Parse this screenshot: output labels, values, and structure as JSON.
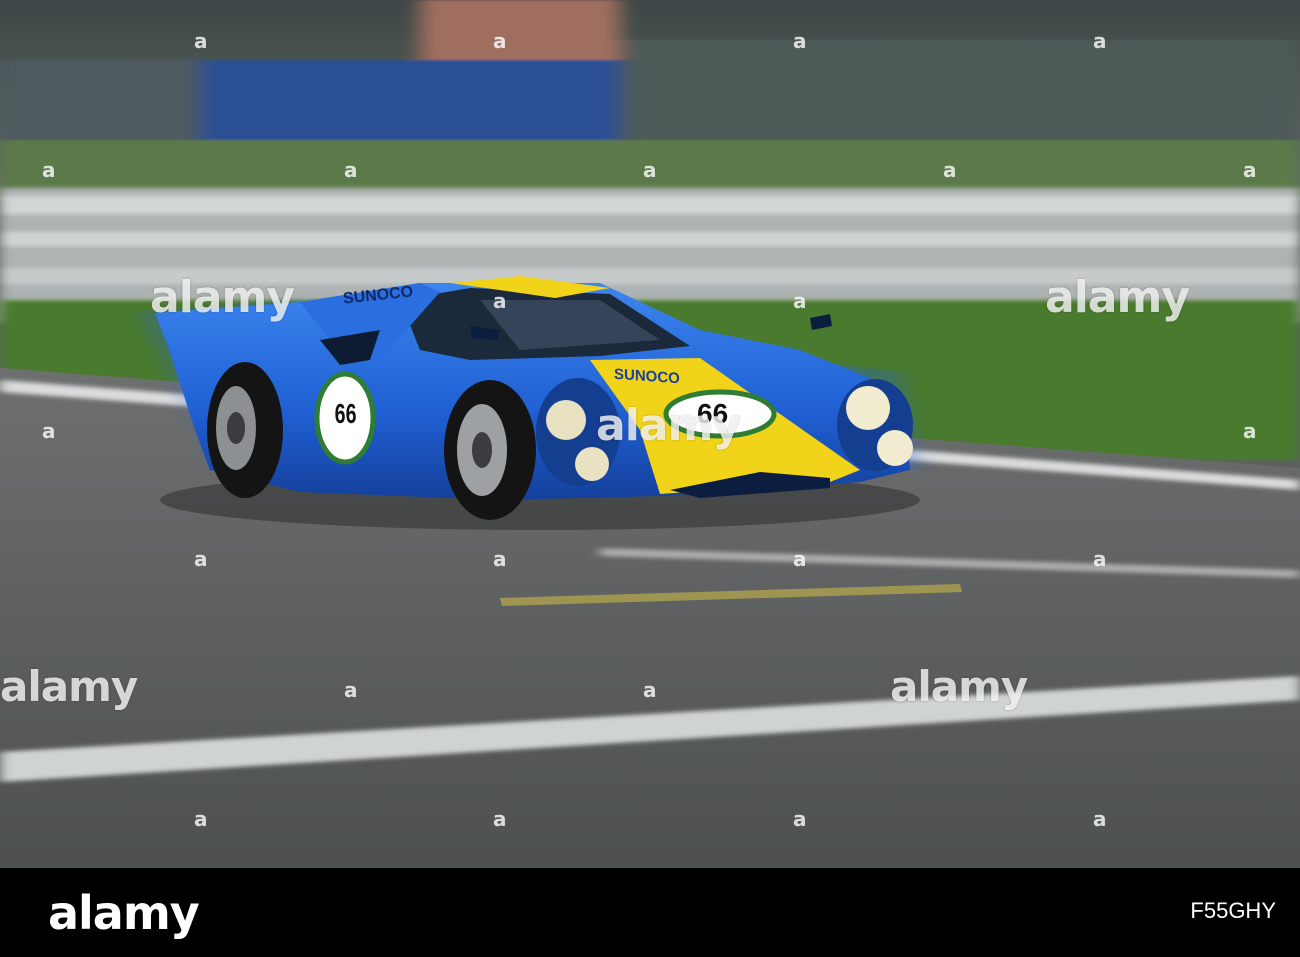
{
  "photo": {
    "subject": "blue and yellow classic race car number 66 on track",
    "car_number": "66",
    "hood_sponsor": "SUNOCO",
    "roof_sponsor": "SUNOCO",
    "colors": {
      "car_blue": "#1f63d6",
      "car_yellow": "#f1d319",
      "track": "#5b5e5f",
      "grass": "#4b7a2e",
      "barrier": "#b9bdbd"
    }
  },
  "watermark": {
    "text": "alamy",
    "mark": "a"
  },
  "footer": {
    "logo": "alamy",
    "image_id": "F55GHY"
  }
}
